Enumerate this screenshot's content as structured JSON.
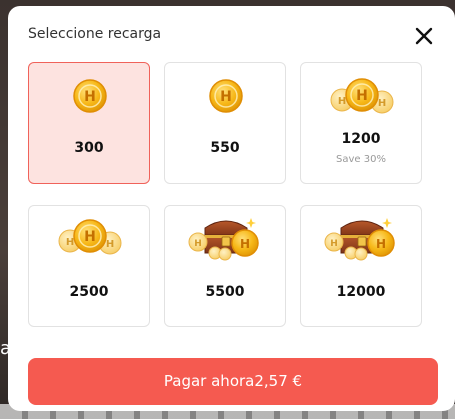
{
  "background": {
    "partial_text": "a"
  },
  "modal": {
    "title": "Seleccione recarga",
    "close_icon": "close-icon"
  },
  "options": [
    {
      "amount": "300",
      "note": "",
      "art": "single-coin",
      "selected": true
    },
    {
      "amount": "550",
      "note": "",
      "art": "single-coin",
      "selected": false
    },
    {
      "amount": "1200",
      "note": "Save 30%",
      "art": "coin-trio",
      "selected": false
    },
    {
      "amount": "2500",
      "note": "",
      "art": "coin-trio",
      "selected": false
    },
    {
      "amount": "5500",
      "note": "",
      "art": "treasure-chest",
      "selected": false
    },
    {
      "amount": "12000",
      "note": "",
      "art": "treasure-chest",
      "selected": false
    }
  ],
  "pay_button": {
    "label": "Pagar ahora",
    "price": "2,57 €"
  },
  "colors": {
    "accent": "#f55a50",
    "selected_bg": "#fde3e0",
    "selected_border": "#f0625a",
    "coin_gold": "#f5b614",
    "coin_pale": "#fbd77a"
  }
}
